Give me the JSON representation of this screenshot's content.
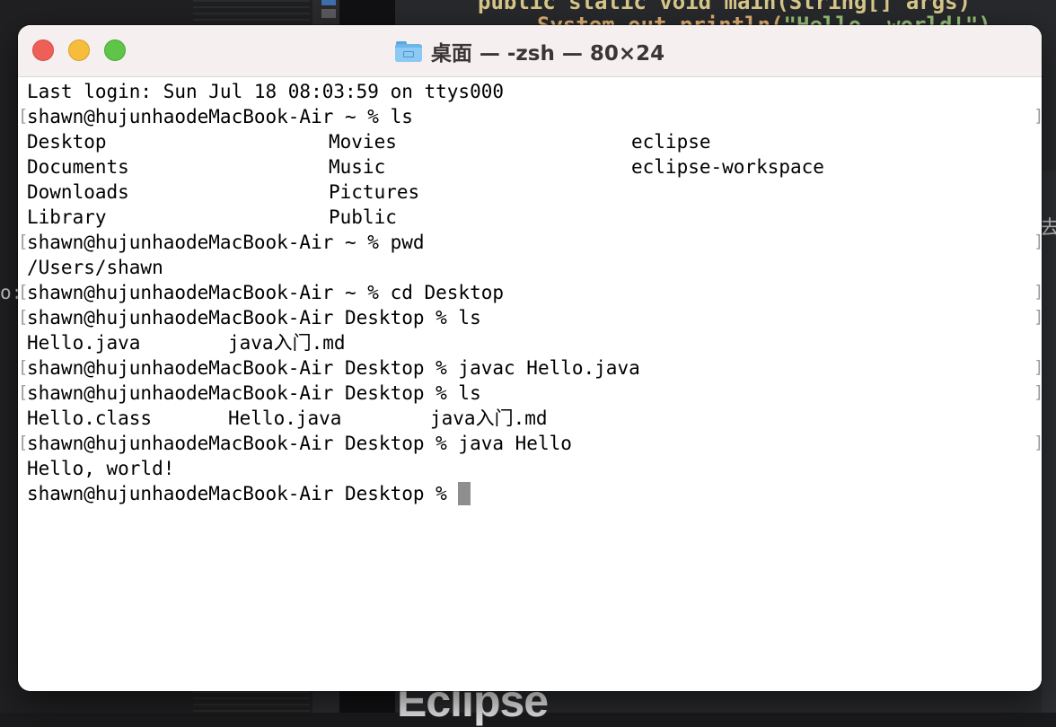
{
  "background": {
    "code_line_1": "public static void main(String[] args)",
    "code_line_2_prefix": "System.out.println(",
    "code_line_2_string": "\"Hello, world!\")",
    "edge_glyph_right": "去",
    "edge_glyph_left": "o:",
    "eclipse_text": "Eclipse"
  },
  "window": {
    "title": "桌面 — -zsh — 80×24",
    "folder_icon": "folder-icon"
  },
  "terminal": {
    "lines": [
      {
        "text": "Last login: Sun Jul 18 08:03:59 on ttys000",
        "mark": false
      },
      {
        "text": "shawn@hujunhaodeMacBook-Air ~ % ls",
        "mark": true
      },
      {
        "cols": [
          "Desktop",
          "Movies",
          "eclipse"
        ],
        "mark": false
      },
      {
        "cols": [
          "Documents",
          "Music",
          "eclipse-workspace"
        ],
        "mark": false
      },
      {
        "cols": [
          "Downloads",
          "Pictures",
          ""
        ],
        "mark": false
      },
      {
        "cols": [
          "Library",
          "Public",
          ""
        ],
        "mark": false
      },
      {
        "text": "shawn@hujunhaodeMacBook-Air ~ % pwd",
        "mark": true
      },
      {
        "text": "/Users/shawn",
        "mark": false
      },
      {
        "text": "shawn@hujunhaodeMacBook-Air ~ % cd Desktop",
        "mark": true
      },
      {
        "text": "shawn@hujunhaodeMacBook-Air Desktop % ls",
        "mark": true
      },
      {
        "cols": [
          "Hello.java",
          "java入门.md"
        ],
        "mark": false
      },
      {
        "text": "shawn@hujunhaodeMacBook-Air Desktop % javac Hello.java",
        "mark": true
      },
      {
        "text": "shawn@hujunhaodeMacBook-Air Desktop % ls",
        "mark": true
      },
      {
        "cols": [
          "Hello.class",
          "Hello.java",
          "java入门.md"
        ],
        "mark": false
      },
      {
        "text": "shawn@hujunhaodeMacBook-Air Desktop % java Hello",
        "mark": true
      },
      {
        "text": "Hello, world!",
        "mark": false
      }
    ],
    "prompt": "shawn@hujunhaodeMacBook-Air Desktop % ",
    "mark_left": "[",
    "mark_right": "]"
  }
}
